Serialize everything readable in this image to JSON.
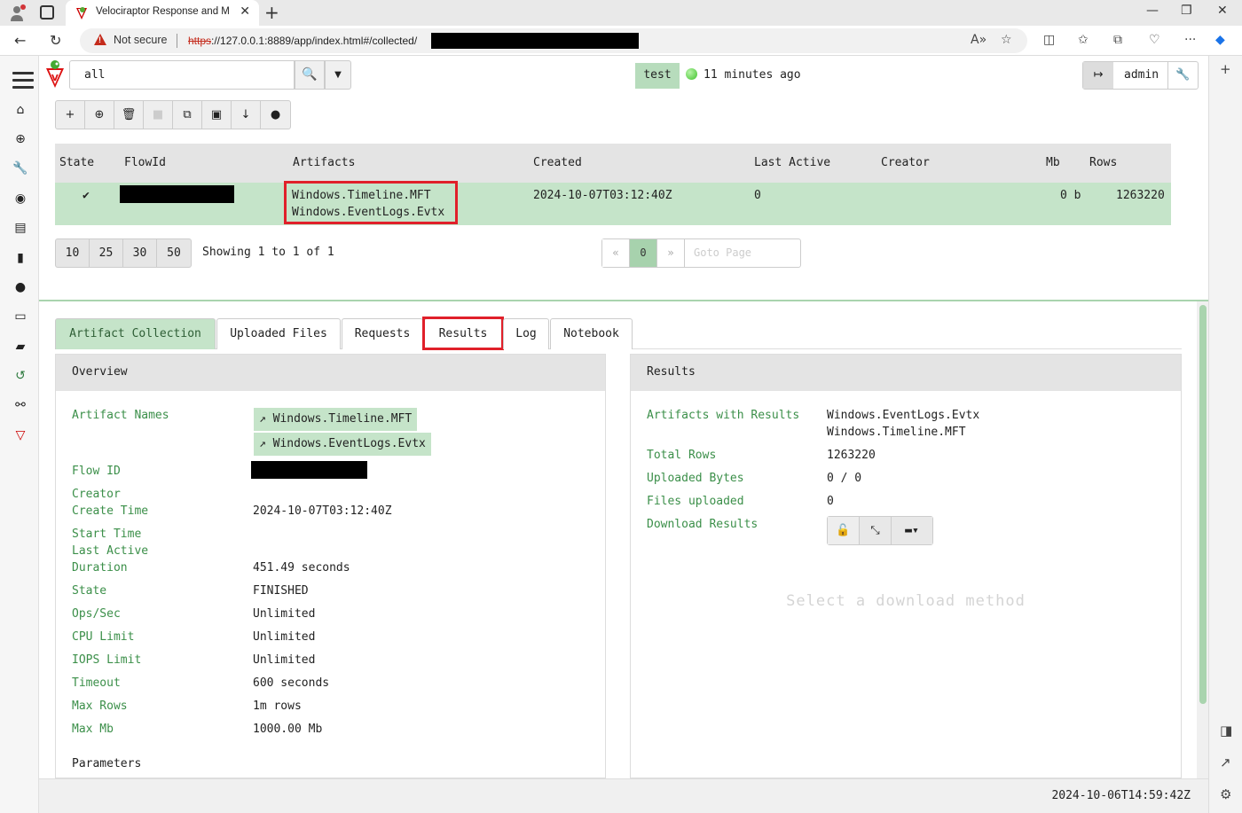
{
  "browser": {
    "tab_title": "Velociraptor Response and Monitoring",
    "not_secure": "Not secure",
    "url_scheme": "https",
    "url_rest": "://127.0.0.1:8889/app/index.html#/collected/"
  },
  "search": {
    "value": "all"
  },
  "client": {
    "name": "test",
    "last_seen": "11 minutes ago"
  },
  "user": {
    "name": "admin"
  },
  "flows_table": {
    "headers": [
      "State",
      "FlowId",
      "Artifacts",
      "Created",
      "Last Active",
      "Creator",
      "Mb",
      "Rows"
    ],
    "row": {
      "state": "✔",
      "artifacts": [
        "Windows.Timeline.MFT",
        "Windows.EventLogs.Evtx"
      ],
      "created": "2024-10-07T03:12:40Z",
      "last_active": "0",
      "creator": "",
      "mb": "0 b",
      "rows": "1263220"
    }
  },
  "pagination": {
    "sizes": [
      "10",
      "25",
      "30",
      "50"
    ],
    "showing": "Showing 1 to 1 of 1",
    "prev": "«",
    "current": "0",
    "next": "»",
    "goto_placeholder": "Goto Page"
  },
  "tabs": [
    "Artifact Collection",
    "Uploaded Files",
    "Requests",
    "Results",
    "Log",
    "Notebook"
  ],
  "overview": {
    "title": "Overview",
    "labels": {
      "artifact_names": "Artifact Names",
      "flow_id": "Flow ID",
      "creator": "Creator",
      "create_time": "Create Time",
      "start_time": "Start Time",
      "last_active": "Last Active",
      "duration": "Duration",
      "state": "State",
      "ops_sec": "Ops/Sec",
      "cpu_limit": "CPU Limit",
      "iops_limit": "IOPS Limit",
      "timeout": "Timeout",
      "max_rows": "Max Rows",
      "max_mb": "Max Mb",
      "parameters": "Parameters"
    },
    "values": {
      "artifacts": [
        "Windows.Timeline.MFT",
        "Windows.EventLogs.Evtx"
      ],
      "create_time": "2024-10-07T03:12:40Z",
      "duration": "451.49 seconds",
      "state": "FINISHED",
      "ops_sec": "Unlimited",
      "cpu_limit": "Unlimited",
      "iops_limit": "Unlimited",
      "timeout": "600 seconds",
      "max_rows": "1m rows",
      "max_mb": "1000.00 Mb"
    }
  },
  "results": {
    "title": "Results",
    "labels": {
      "artifacts_with_results": "Artifacts with Results",
      "total_rows": "Total Rows",
      "uploaded_bytes": "Uploaded Bytes",
      "files_uploaded": "Files uploaded",
      "download_results": "Download Results"
    },
    "values": {
      "artifacts": [
        "Windows.EventLogs.Evtx",
        "Windows.Timeline.MFT"
      ],
      "total_rows": "1263220",
      "uploaded_bytes": "0 / 0",
      "files_uploaded": "0"
    },
    "select_download": "Select a download method"
  },
  "footer": {
    "timestamp": "2024-10-06T14:59:42Z"
  },
  "colors": {
    "accent_green": "#c5e4c9",
    "label_green": "#3b8f49",
    "highlight_red": "#e0202a"
  }
}
